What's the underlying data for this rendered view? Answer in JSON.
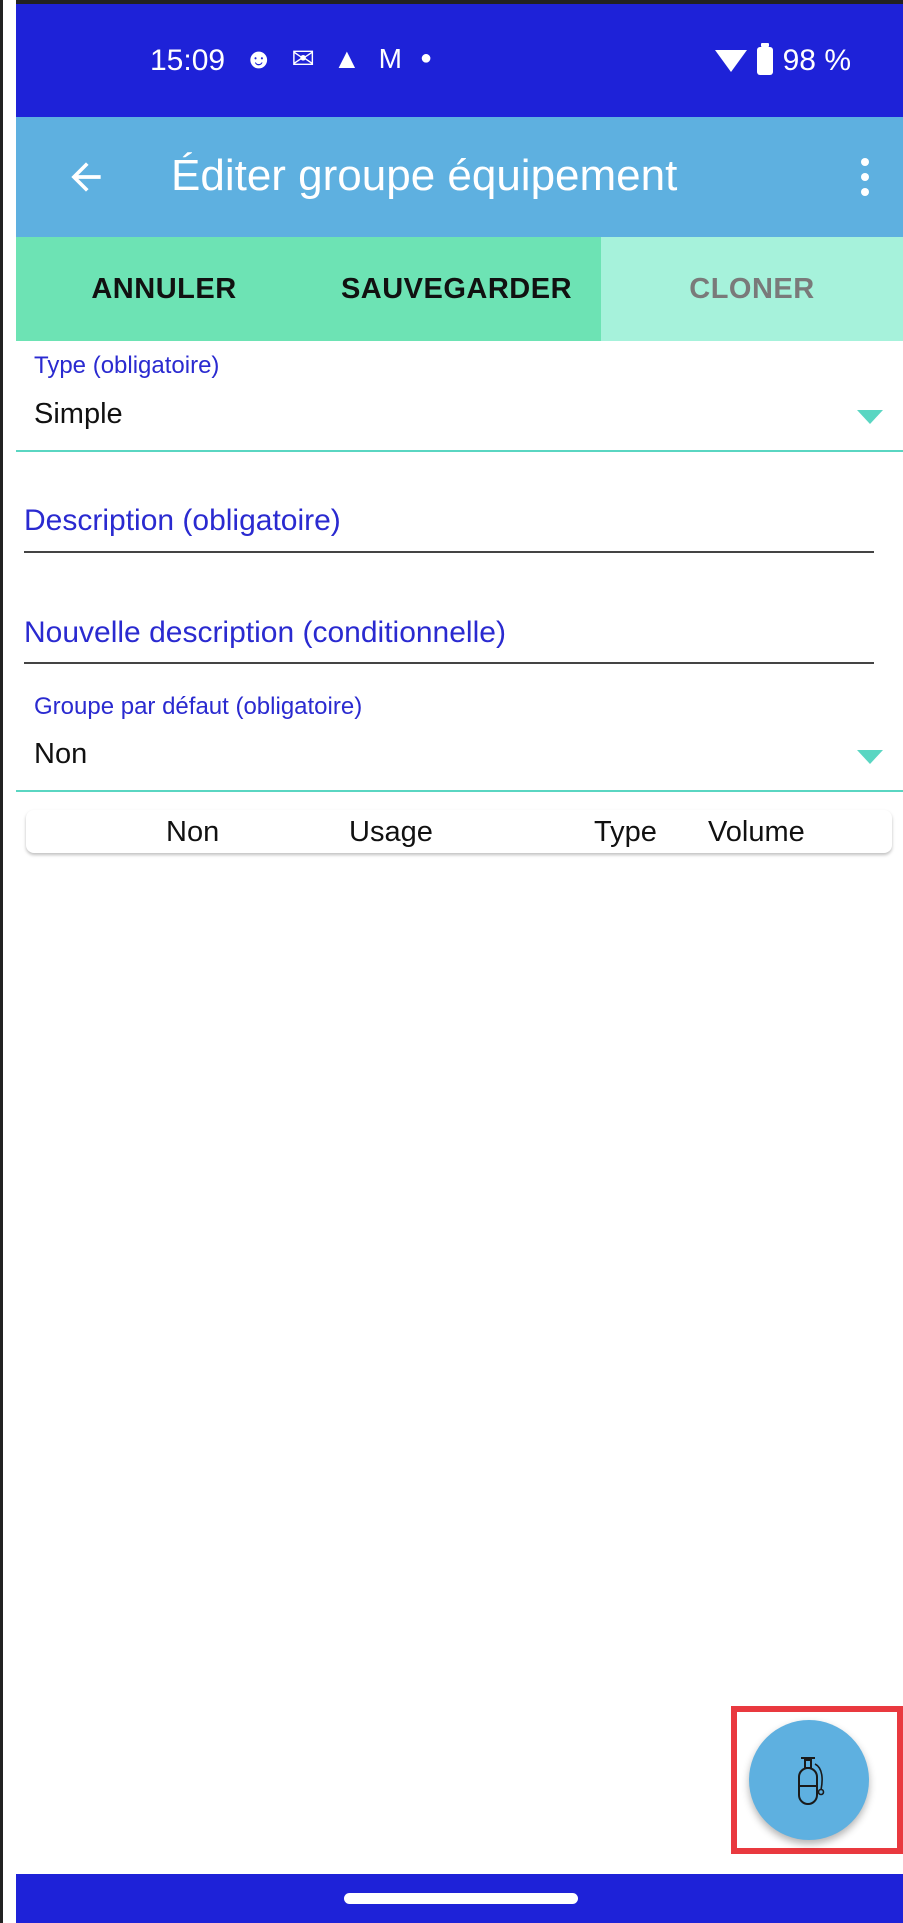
{
  "status_bar": {
    "time": "15:09",
    "battery": "98 %",
    "icons": [
      "face-icon",
      "gmail-icon",
      "warning-icon",
      "malwarebytes-icon",
      "dot-icon",
      "wifi-icon",
      "battery-charging-icon"
    ]
  },
  "app_bar": {
    "title": "Éditer groupe équipement",
    "back_icon": "arrow-left-icon",
    "menu_icon": "more-vert-icon"
  },
  "actions": {
    "cancel_label": "ANNULER",
    "save_label": "SAUVEGARDER",
    "clone_label": "CLONER"
  },
  "form": {
    "type_label": "Type (obligatoire)",
    "type_value": "Simple",
    "description_label": "Description (obligatoire)",
    "new_description_label": "Nouvelle description (conditionnelle)",
    "default_group_label": "Groupe par défaut (obligatoire)",
    "default_group_value": "Non"
  },
  "table": {
    "columns": [
      "Non",
      "Usage",
      "Type",
      "Volume"
    ]
  },
  "fab": {
    "icon": "gas-cylinder-icon"
  },
  "colors": {
    "status_bar": "#1e22d8",
    "app_bar": "#5eb0e0",
    "action_active": "#6de3b4",
    "action_disabled": "#a6f2db",
    "label": "#2a2ad0",
    "accent_line": "#5ad6c2",
    "highlight": "#e9393f"
  }
}
